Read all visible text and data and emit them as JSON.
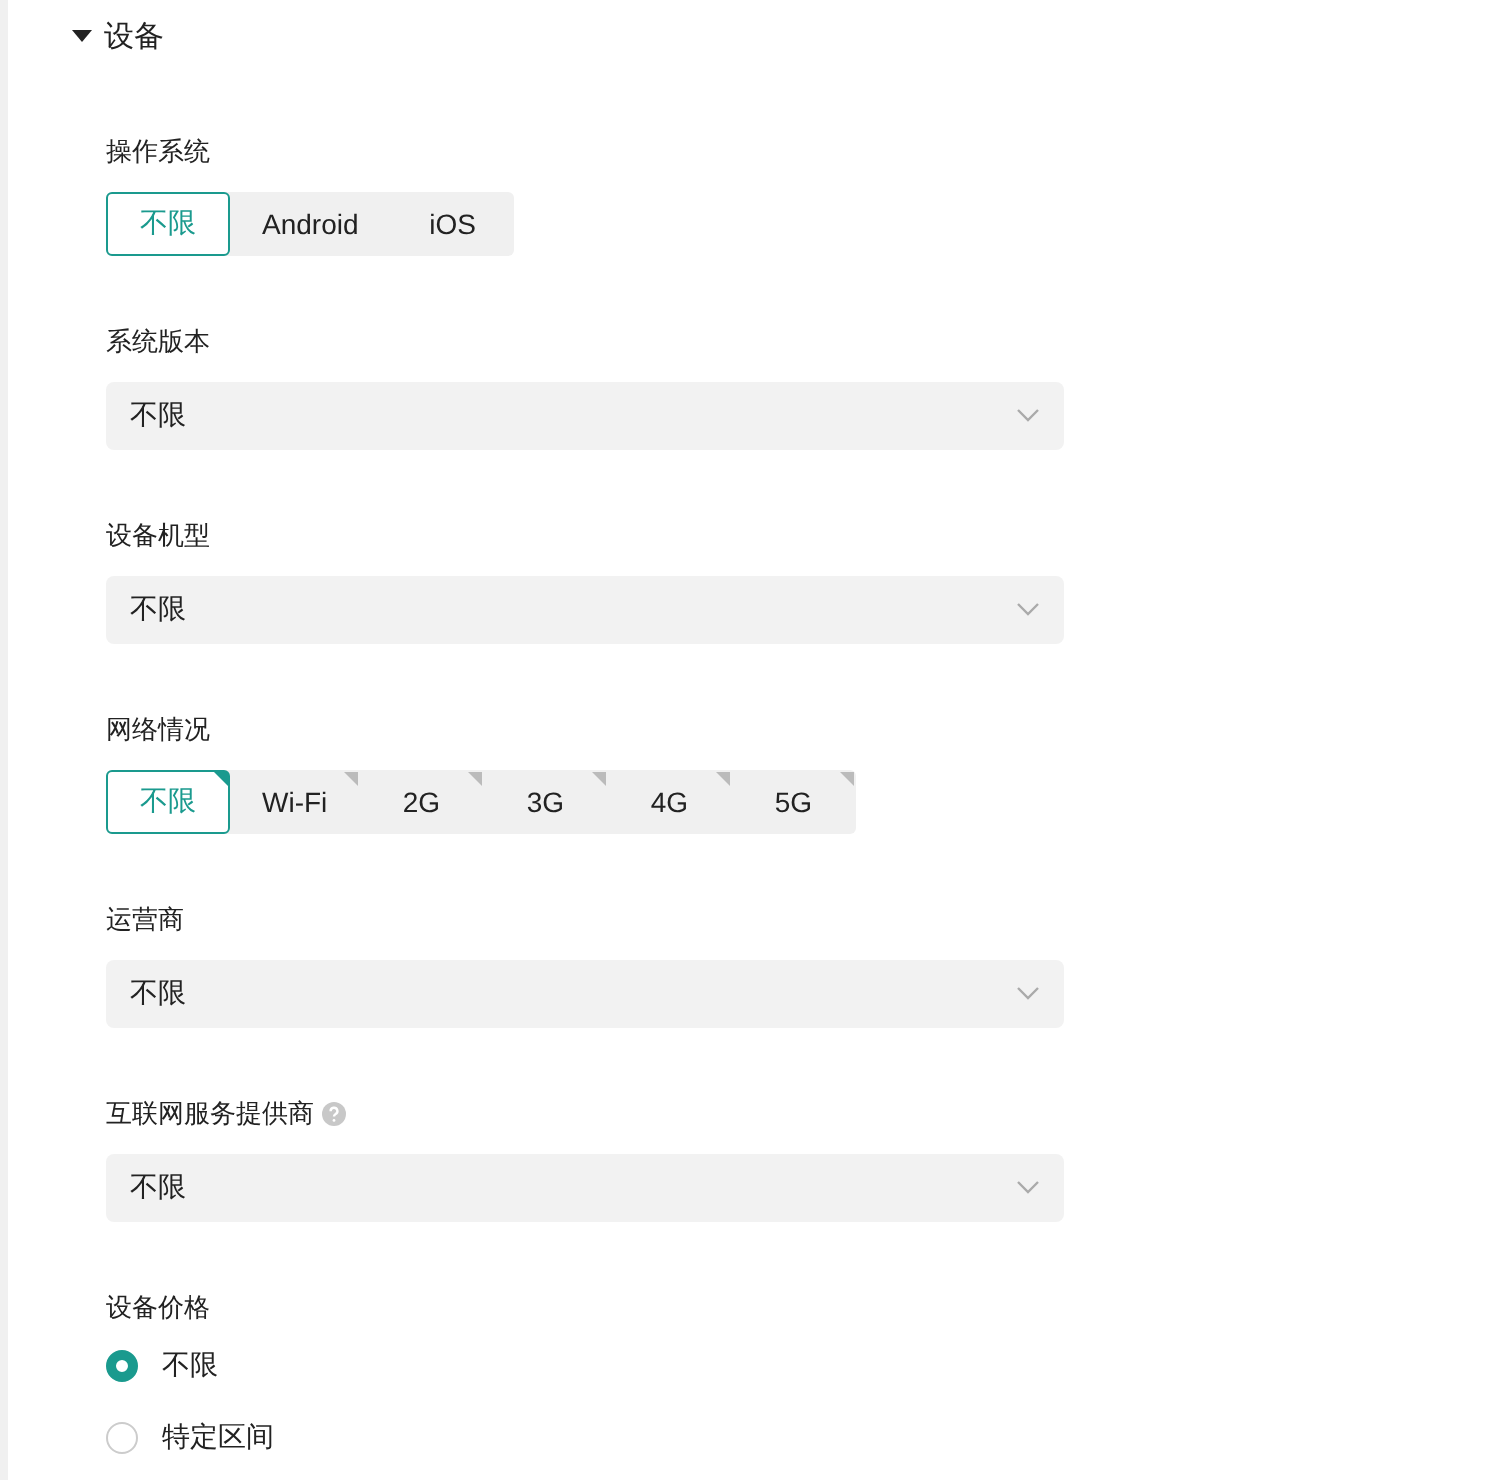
{
  "section": {
    "title": "设备",
    "expanded": true
  },
  "fields": [
    {
      "kind": "segmented",
      "label": "操作系统",
      "options": [
        {
          "label": "不限",
          "selected": true,
          "corner_mark": false
        },
        {
          "label": "Android",
          "selected": false,
          "corner_mark": false
        },
        {
          "label": "iOS",
          "selected": false,
          "corner_mark": false
        }
      ]
    },
    {
      "kind": "select",
      "label": "系统版本",
      "value": "不限"
    },
    {
      "kind": "select",
      "label": "设备机型",
      "value": "不限"
    },
    {
      "kind": "segmented",
      "label": "网络情况",
      "options": [
        {
          "label": "不限",
          "selected": true,
          "corner_mark": true
        },
        {
          "label": "Wi-Fi",
          "selected": false,
          "corner_mark": true
        },
        {
          "label": "2G",
          "selected": false,
          "corner_mark": true
        },
        {
          "label": "3G",
          "selected": false,
          "corner_mark": true
        },
        {
          "label": "4G",
          "selected": false,
          "corner_mark": true
        },
        {
          "label": "5G",
          "selected": false,
          "corner_mark": true
        }
      ]
    },
    {
      "kind": "select",
      "label": "运营商",
      "value": "不限"
    },
    {
      "kind": "select",
      "label": "互联网服务提供商",
      "help": true,
      "value": "不限"
    },
    {
      "kind": "radio",
      "label": "设备价格",
      "options": [
        {
          "label": "不限",
          "selected": true
        },
        {
          "label": "特定区间",
          "selected": false
        }
      ]
    }
  ]
}
